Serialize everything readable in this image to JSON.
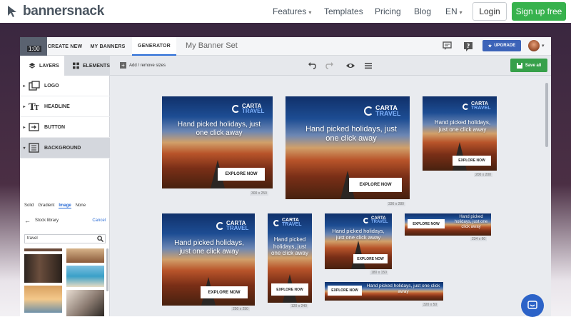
{
  "site": {
    "brand": "bannersnack",
    "nav": [
      {
        "label": "Features",
        "caret": true
      },
      {
        "label": "Templates",
        "caret": false
      },
      {
        "label": "Pricing",
        "caret": false
      },
      {
        "label": "Blog",
        "caret": false
      },
      {
        "label": "EN",
        "caret": true
      }
    ],
    "login": "Login",
    "signup": "Sign up free"
  },
  "app": {
    "time_badge": "1:00",
    "tabs": [
      "CREATE NEW",
      "MY BANNERS",
      "GENERATOR"
    ],
    "active_tab": "GENERATOR",
    "set_title": "My Banner Set",
    "upgrade": "UPGRADE",
    "side_tabs": [
      "LAYERS",
      "ELEMENTS"
    ],
    "add_remove": "Add / remove sizes",
    "save_all": "Save all",
    "layers": [
      "LOGO",
      "HEADLINE",
      "BUTTON",
      "BACKGROUND"
    ],
    "bg_options": [
      "Solid",
      "Gradient",
      "Image",
      "None"
    ],
    "bg_active": "Image",
    "stock_library": "Stock library",
    "cancel": "Cancel",
    "search_value": "travel"
  },
  "banner": {
    "brand": "CARTA",
    "brand_sub": "TRAVEL",
    "headline": "Hand picked holidays, just one click away",
    "cta": "EXPLORE NOW"
  },
  "banners": [
    {
      "size": "300 x 250"
    },
    {
      "size": "336 x 280"
    },
    {
      "size": "200 x 200"
    },
    {
      "size": "250 x 250"
    },
    {
      "size": "120 x 240"
    },
    {
      "size": "180 x 150"
    },
    {
      "size": "234 x 60"
    },
    {
      "size": "320 x 50"
    }
  ],
  "colors": {
    "accent_blue": "#2a6cd6",
    "signup_green": "#37b24d",
    "save_green": "#37a04a",
    "upgrade_blue": "#3c63b8"
  }
}
